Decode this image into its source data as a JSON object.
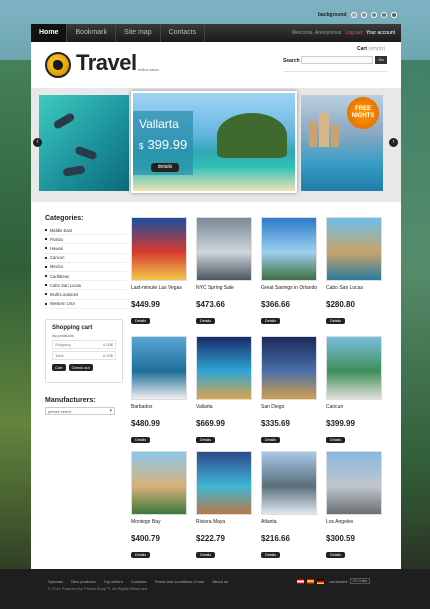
{
  "background_switch": {
    "label": "background",
    "swatches": [
      "#9aa1a6",
      "#8a8f93",
      "#7a7f83",
      "#6a6f73",
      "#5a5f63"
    ]
  },
  "nav": {
    "items": [
      "Home",
      "Bookmark",
      "Site map",
      "Contacts"
    ],
    "welcome": "Welcome, Anonymous",
    "login": "Log out",
    "account": "Your account"
  },
  "header": {
    "logo": "Travel",
    "logo_sub": "online store",
    "cart_label": "Cart",
    "cart_count": "(empty)",
    "search_label": "Search",
    "search_button": "Go"
  },
  "slider": {
    "title": "Vallarta",
    "currency": "$",
    "price": "399.99",
    "details": "details",
    "badge_line1": "FREE",
    "badge_line2": "NIGHTS",
    "prev": "‹",
    "next": "›"
  },
  "sidebar": {
    "categories_title": "Categories:",
    "categories": [
      "Middle East",
      "Florida",
      "Hawaii",
      "Cancun",
      "Mexico",
      "Caribbean",
      "Cabo San Lucas",
      "Multi-Locations",
      "Western USA"
    ],
    "cart": {
      "title": "Shopping cart",
      "no_products": "No products",
      "shipping_label": "Shipping",
      "shipping_value": "0.00$",
      "total_label": "Total",
      "total_value": "0.00$",
      "cart_btn": "Cart",
      "checkout_btn": "Check out"
    },
    "manufacturers_title": "Manufacturers:",
    "manufacturers_select": "please select"
  },
  "products": [
    {
      "name": "Last-minute Las Vegas",
      "price": "$449.99",
      "details": "Details",
      "colors": [
        "#1a4fa0",
        "#d73a2e",
        "#f2c94c"
      ]
    },
    {
      "name": "NYC Spring Sale",
      "price": "$473.66",
      "details": "Details",
      "colors": [
        "#7a8896",
        "#cfd6dc",
        "#4b5561"
      ]
    },
    {
      "name": "Great Savings in Orlando",
      "price": "$366.66",
      "details": "Details",
      "colors": [
        "#2b7ac9",
        "#9ed0f0",
        "#3e6e3e"
      ]
    },
    {
      "name": "Cabo San Lucas",
      "price": "$280.80",
      "details": "Details",
      "colors": [
        "#6cc0ea",
        "#c9a46b",
        "#2a7b9e"
      ]
    },
    {
      "name": "Barbados",
      "price": "$480.99",
      "details": "Details",
      "colors": [
        "#5aa6d6",
        "#1e6e9a",
        "#f0f0f0"
      ]
    },
    {
      "name": "Vallarta",
      "price": "$669.99",
      "details": "Details",
      "colors": [
        "#1a2a6a",
        "#2fa6d6",
        "#d9a34a"
      ]
    },
    {
      "name": "San Diego",
      "price": "$335.69",
      "details": "Details",
      "colors": [
        "#1a2a5a",
        "#4a6ea8",
        "#d0a050"
      ]
    },
    {
      "name": "Cancun",
      "price": "$399.99",
      "details": "Details",
      "colors": [
        "#7abde0",
        "#3e8e5a",
        "#e0e0d8"
      ]
    },
    {
      "name": "Montego Bay",
      "price": "$400.79",
      "details": "Details",
      "colors": [
        "#8dc7ea",
        "#d8b07a",
        "#3a7a3a"
      ]
    },
    {
      "name": "Riviera Maya",
      "price": "$222.79",
      "details": "Details",
      "colors": [
        "#2b4a8a",
        "#3fb6d6",
        "#b87a4a"
      ]
    },
    {
      "name": "Atlanta",
      "price": "$216.66",
      "details": "Details",
      "colors": [
        "#a8c8e8",
        "#5a6e7a",
        "#dfe8ef"
      ]
    },
    {
      "name": "Los Angeles",
      "price": "$300.59",
      "details": "Details",
      "colors": [
        "#8ab8e0",
        "#c0c6cc",
        "#6a6f74"
      ]
    }
  ],
  "footer": {
    "links": [
      "Specials",
      "New products",
      "Top sellers",
      "Contacts",
      "Terms and conditions of use",
      "About us"
    ],
    "copyright": "© 2011 Powered by Presta Shop™. All Rights Reserved",
    "currency_label": "currencies",
    "currency_value": "US Dollar"
  }
}
